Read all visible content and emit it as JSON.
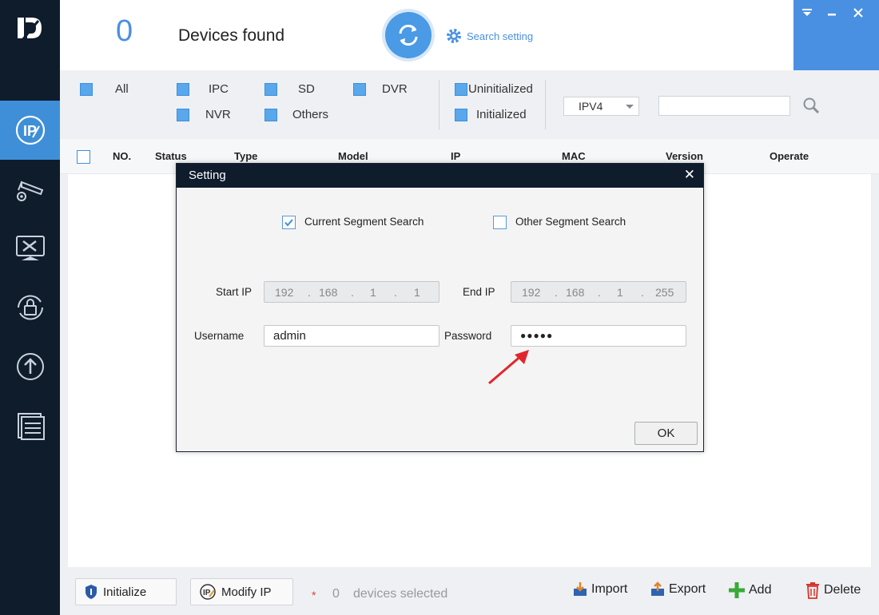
{
  "header": {
    "count": "0",
    "found_label": "Devices found",
    "search_setting_label": "Search setting"
  },
  "filters": {
    "all": "All",
    "ipc": "IPC",
    "sd": "SD",
    "dvr": "DVR",
    "nvr": "NVR",
    "others": "Others",
    "uninitialized": "Uninitialized",
    "initialized": "Initialized",
    "ip_version": "IPV4",
    "search_value": ""
  },
  "table": {
    "columns": [
      "NO.",
      "Status",
      "Type",
      "Model",
      "IP",
      "MAC",
      "Version",
      "Operate"
    ]
  },
  "modal": {
    "title": "Setting",
    "current_segment": "Current Segment Search",
    "other_segment": "Other Segment Search",
    "start_ip_label": "Start IP",
    "start_ip": [
      "192",
      "168",
      "1",
      "1"
    ],
    "end_ip_label": "End IP",
    "end_ip": [
      "192",
      "168",
      "1",
      "255"
    ],
    "username_label": "Username",
    "username": "admin",
    "password_label": "Password",
    "password": "●●●●●",
    "ok": "OK"
  },
  "bottom": {
    "initialize": "Initialize",
    "modify_ip": "Modify IP",
    "star": "*",
    "selected_count": "0",
    "selected_text": "devices selected",
    "import": "Import",
    "export": "Export",
    "add": "Add",
    "delete": "Delete"
  },
  "colors": {
    "sidebar": "#0f1c2c",
    "accent": "#4a90e2",
    "active_nav": "#3f8fd8",
    "arrow": "#e0262b"
  }
}
